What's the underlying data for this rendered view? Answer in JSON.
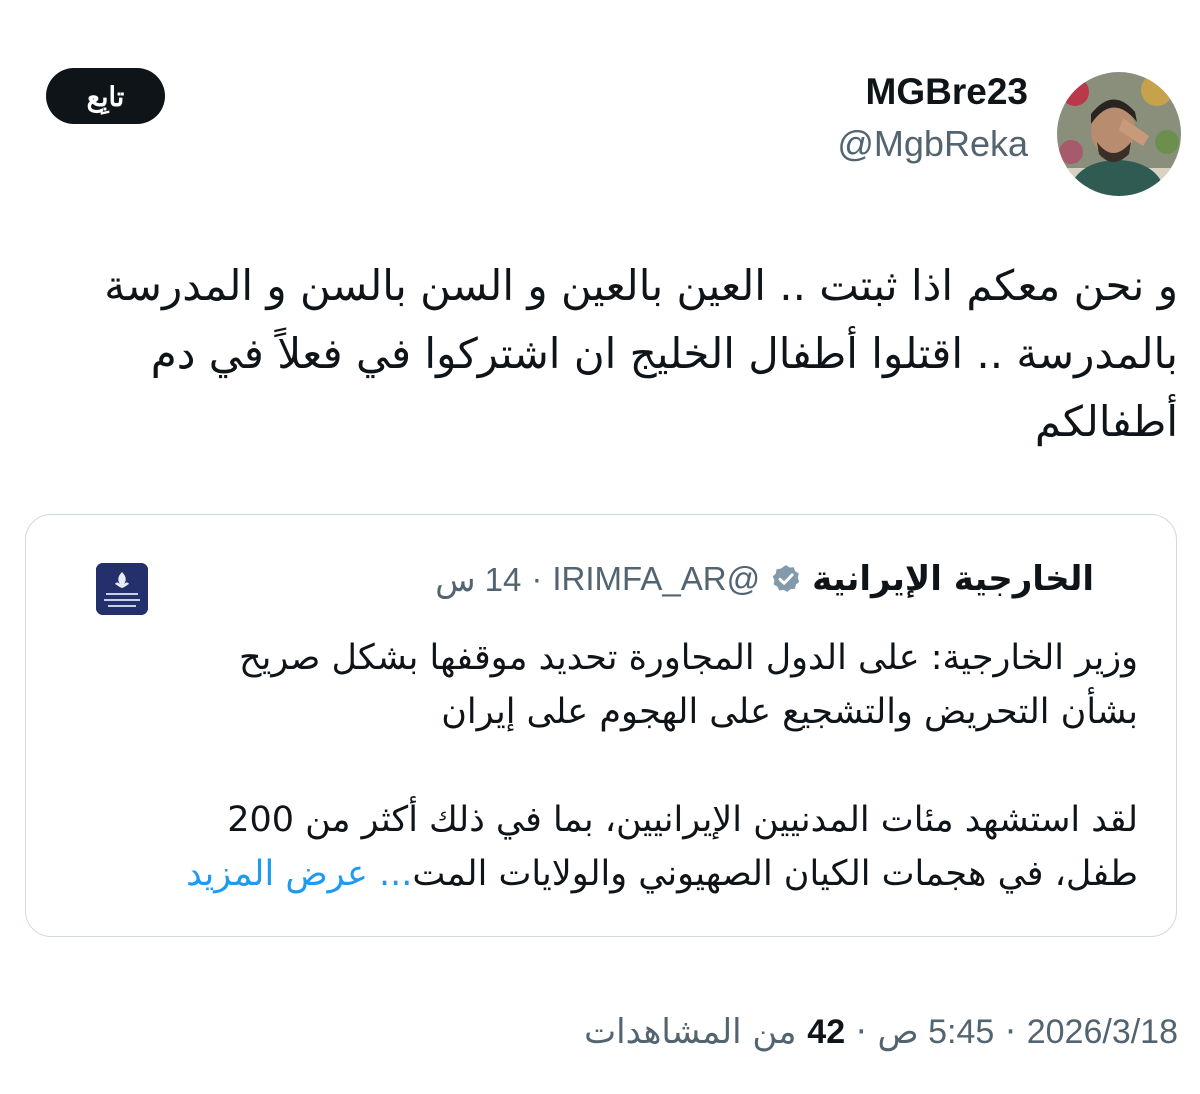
{
  "author": {
    "display_name": "MGBre23",
    "handle": "@MgbReka"
  },
  "follow_button": {
    "label": "تابِع"
  },
  "tweet": {
    "text_lines": [
      "و نحن معكم اذا ثبتت .. العين بالعين و السن بالسن و المدرسة",
      "بالمدرسة .. اقتلوا أطفال الخليج ان اشتركوا في فعلاً في دم",
      "أطفالكم"
    ]
  },
  "quoted_tweet": {
    "display_name": "الخارجية الإيرانية",
    "handle": "@IRIMFA_AR",
    "dot": "·",
    "time": "14 س",
    "paragraph_1_lines": [
      "وزير الخارجية: على الدول المجاورة تحديد موقفها بشكل صريح",
      "بشأن التحريض والتشجيع على الهجوم على إيران"
    ],
    "paragraph_2_line_1": "لقد استشهد مئات المدنيين الإيرانيين، بما في ذلك أكثر من 200",
    "paragraph_2_line_2": "طفل، في هجمات الكيان الصهيوني والولايات المت",
    "show_more": "... عرض المزيد"
  },
  "meta": {
    "date": "2026/3/18",
    "separator": "·",
    "time": "5:45 ص",
    "views_count": "42",
    "views_label": "من المشاهدات"
  },
  "colors": {
    "text_primary": "#0f1419",
    "text_secondary": "#536471",
    "link": "#1d9bf0",
    "border": "#cfd9de",
    "follow_button_bg": "#0f1419",
    "verified_badge": "#829aab",
    "ministry_logo_bg": "#24306b"
  },
  "icons": {
    "verified": "verified-badge-icon",
    "ministry_logo": "ministry-logo-icon"
  }
}
